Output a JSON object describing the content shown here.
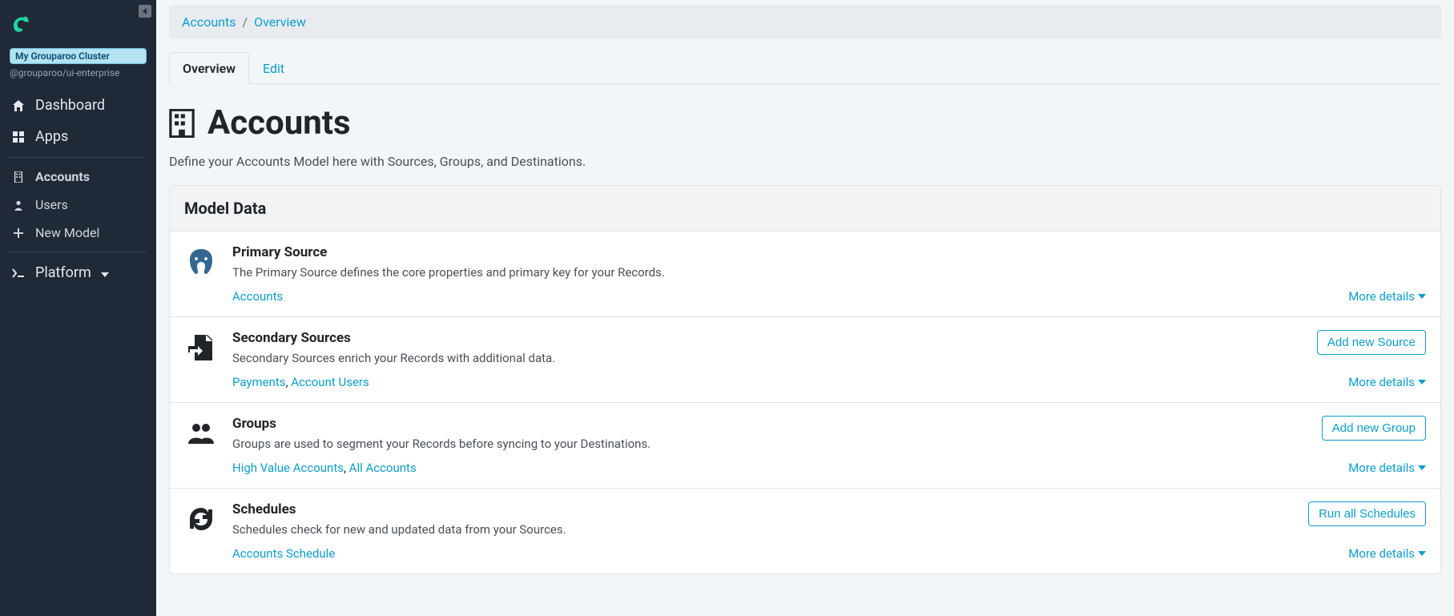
{
  "sidebar": {
    "cluster_name": "My Grouparoo Cluster",
    "cluster_sub": "@grouparoo/ui-enterprise",
    "nav": {
      "dashboard": "Dashboard",
      "apps": "Apps",
      "accounts": "Accounts",
      "users": "Users",
      "new_model": "New Model",
      "platform": "Platform"
    }
  },
  "breadcrumb": {
    "model": "Accounts",
    "page": "Overview"
  },
  "tabs": {
    "overview": "Overview",
    "edit": "Edit"
  },
  "page": {
    "title": "Accounts",
    "description": "Define your Accounts Model here with Sources, Groups, and Destinations."
  },
  "model_data": {
    "header": "Model Data",
    "more_details": "More details",
    "primary_source": {
      "title": "Primary Source",
      "description": "The Primary Source defines the core properties and primary key for your Records.",
      "links": [
        "Accounts"
      ]
    },
    "secondary_sources": {
      "title": "Secondary Sources",
      "description": "Secondary Sources enrich your Records with additional data.",
      "action": "Add new Source",
      "links": [
        "Payments",
        "Account Users"
      ]
    },
    "groups": {
      "title": "Groups",
      "description": "Groups are used to segment your Records before syncing to your Destinations.",
      "action": "Add new Group",
      "links": [
        "High Value Accounts",
        "All Accounts"
      ]
    },
    "schedules": {
      "title": "Schedules",
      "description": "Schedules check for new and updated data from your Sources.",
      "action": "Run all Schedules",
      "links": [
        "Accounts Schedule"
      ]
    }
  }
}
